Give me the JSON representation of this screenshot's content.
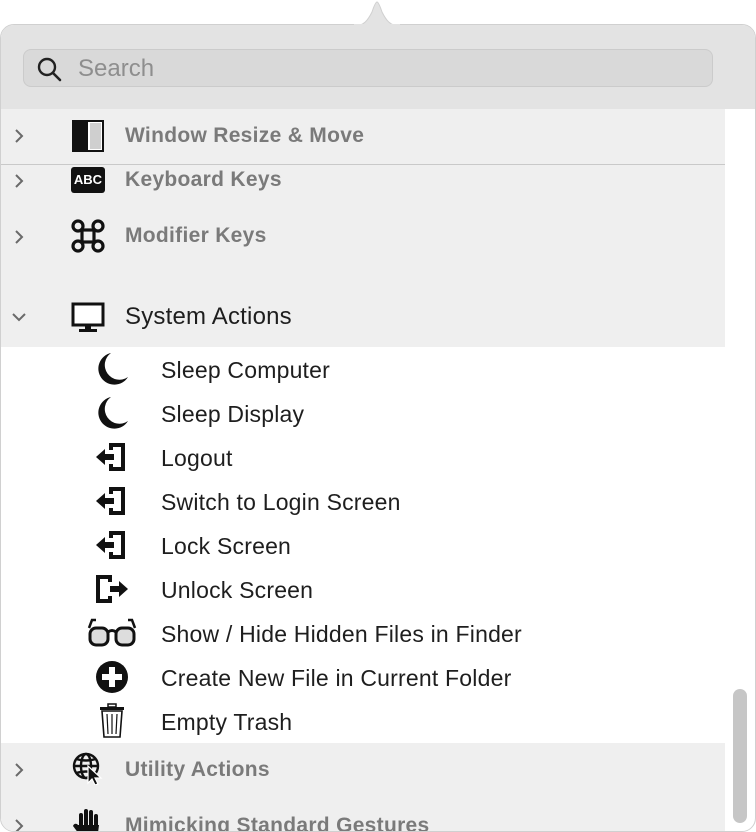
{
  "search": {
    "placeholder": "Search"
  },
  "categories_top": [
    {
      "label": "Window Resize & Move",
      "icon": "window-resize-icon"
    },
    {
      "label": "Keyboard Keys",
      "icon": "abc-keyboard-icon",
      "icon_text": "ABC"
    },
    {
      "label": "Modifier Keys",
      "icon": "command-key-icon"
    }
  ],
  "expanded_category": {
    "label": "System Actions",
    "icon": "monitor-icon"
  },
  "system_actions": [
    {
      "label": "Sleep Computer",
      "icon": "moon-icon"
    },
    {
      "label": "Sleep Display",
      "icon": "moon-icon"
    },
    {
      "label": "Logout",
      "icon": "logout-icon"
    },
    {
      "label": "Switch to Login Screen",
      "icon": "logout-icon"
    },
    {
      "label": "Lock Screen",
      "icon": "logout-icon"
    },
    {
      "label": "Unlock Screen",
      "icon": "login-exit-icon"
    },
    {
      "label": "Show / Hide Hidden Files in Finder",
      "icon": "glasses-icon"
    },
    {
      "label": "Create New File in Current Folder",
      "icon": "plus-circle-icon"
    },
    {
      "label": "Empty Trash",
      "icon": "trash-icon"
    }
  ],
  "categories_bottom": [
    {
      "label": "Utility Actions",
      "icon": "globe-cursor-icon"
    },
    {
      "label": "Mimicking Standard Gestures",
      "icon": "hand-icon"
    }
  ]
}
